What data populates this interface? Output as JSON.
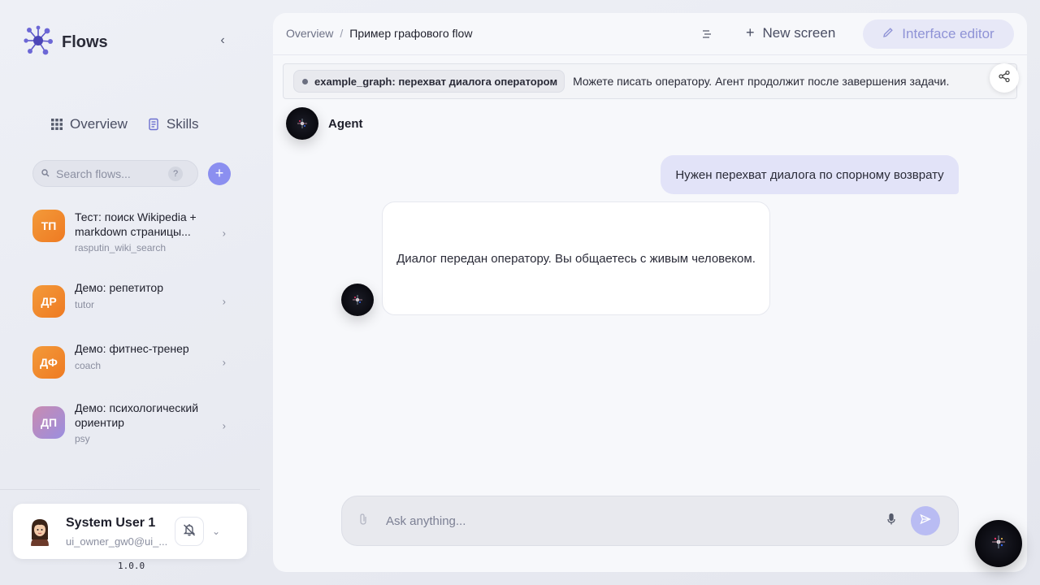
{
  "brand": {
    "name": "Flows",
    "logo_icon": "molecule-logo-icon"
  },
  "sidebar": {
    "nav": [
      {
        "label": "Overview",
        "icon": "grid-icon"
      },
      {
        "label": "Skills",
        "icon": "scroll-icon"
      }
    ],
    "search": {
      "placeholder": "Search flows...",
      "help": "?"
    },
    "flows": [
      {
        "initials": "ТП",
        "title": "Тест: поиск Wikipedia + markdown страницы...",
        "slug": "rasputin_wiki_search",
        "color": "#f08a2c"
      },
      {
        "initials": "ДР",
        "title": "Демо: репетитор",
        "slug": "tutor",
        "color": "#f08a2c"
      },
      {
        "initials": "ДФ",
        "title": "Демо: фитнес-тренер",
        "slug": "coach",
        "color": "#f08a2c"
      },
      {
        "initials": "ДП",
        "title": "Демо: психологический ориентир",
        "slug": "psy",
        "color": "#a68bd6"
      }
    ],
    "user": {
      "name": "System User 1",
      "email": "ui_owner_gw0@ui_..."
    },
    "version": "1.0.0"
  },
  "topbar": {
    "breadcrumb_root": "Overview",
    "breadcrumb_sep": "/",
    "breadcrumb_current": "Пример графового flow",
    "new_screen_label": "New screen",
    "interface_editor_label": "Interface editor"
  },
  "banner": {
    "chip_label": "example_graph: перехват диалога оператором",
    "text": "Можете писать оператору. Агент продолжит после завершения задачи."
  },
  "chat": {
    "agent_name": "Agent",
    "messages": [
      {
        "role": "user",
        "text": "Нужен перехват диалога по спорному возврату"
      },
      {
        "role": "bot",
        "text": "Диалог передан оператору. Вы общаетесь с живым человеком."
      }
    ]
  },
  "composer": {
    "placeholder": "Ask anything..."
  },
  "colors": {
    "accent": "#8b8ff0",
    "user_bubble": "#e2e3f8",
    "editor_btn": "#e7e8f7"
  }
}
